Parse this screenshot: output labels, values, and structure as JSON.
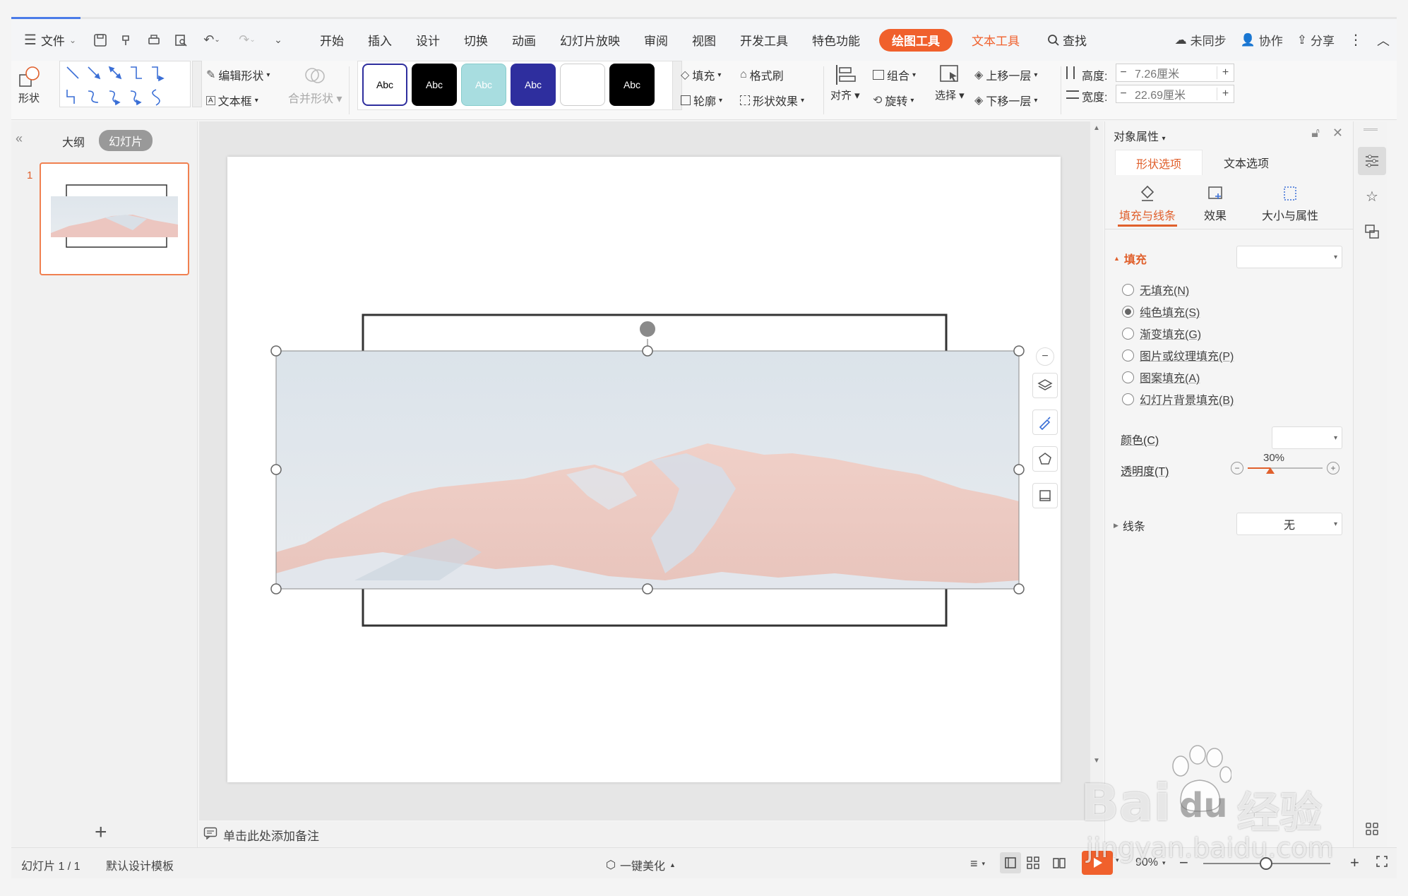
{
  "menu": {
    "file_label": "文件",
    "tabs": [
      "开始",
      "插入",
      "设计",
      "切换",
      "动画",
      "幻灯片放映",
      "审阅",
      "视图",
      "开发工具",
      "特色功能"
    ],
    "draw_tools": "绘图工具",
    "text_tools": "文本工具",
    "search": "查找",
    "sync": "未同步",
    "collab": "协作",
    "share": "分享"
  },
  "ribbon": {
    "shape": "形状",
    "edit_shape": "编辑形状",
    "textbox": "文本框",
    "merge_shape": "合并形状",
    "styles": [
      "Abc",
      "Abc",
      "Abc",
      "Abc",
      "",
      "Abc"
    ],
    "style_colors": [
      "#ffffff",
      "#000000",
      "#a8dde0",
      "#2e2e9e",
      "#ffffff",
      "#000000"
    ],
    "fill": "填充",
    "format_painter": "格式刷",
    "outline": "轮廓",
    "shape_effect": "形状效果",
    "align": "对齐",
    "group": "组合",
    "rotate": "旋转",
    "select": "选择",
    "bring_forward": "上移一层",
    "send_backward": "下移一层",
    "height_label": "高度:",
    "height_value": "7.26厘米",
    "width_label": "宽度:",
    "width_value": "22.69厘米"
  },
  "left_panel": {
    "outline_tab": "大纲",
    "slides_tab": "幻灯片",
    "slide_number": "1"
  },
  "notes": {
    "placeholder": "单击此处添加备注"
  },
  "right_panel": {
    "title": "对象属性",
    "tab_shape": "形状选项",
    "tab_text": "文本选项",
    "sub_fill_line": "填充与线条",
    "sub_effect": "效果",
    "sub_size": "大小与属性",
    "fill_section": "填充",
    "fill_options": [
      "无填充(N)",
      "纯色填充(S)",
      "渐变填充(G)",
      "图片或纹理填充(P)",
      "图案填充(A)",
      "幻灯片背景填充(B)"
    ],
    "selected_fill_index": 1,
    "color_label": "颜色(C)",
    "transparency_label": "透明度(T)",
    "transparency_value": "30%",
    "line_section": "线条",
    "line_value": "无"
  },
  "status": {
    "slide_info": "幻灯片 1 / 1",
    "template": "默认设计模板",
    "beautify": "一键美化",
    "zoom": "90%"
  },
  "watermark": {
    "brand": "Bai",
    "brand2": "du",
    "jingyan": "经验",
    "url": "jingyan.baidu.com"
  },
  "colors": {
    "accent": "#f0602c",
    "selected_border": "#f08050"
  }
}
